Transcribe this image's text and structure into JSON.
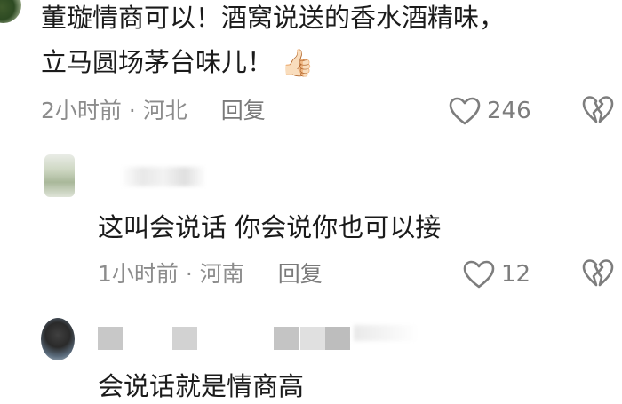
{
  "comment1": {
    "line1": "董璇情商可以！酒窝说送的香水酒精味，",
    "line2": "立马圆场茅台味儿！",
    "emoji": "👍🏻",
    "meta": "2小时前 · 河北",
    "reply_label": "回复",
    "likes": "246"
  },
  "comment2": {
    "text": "这叫会说话 你会说你也可以接",
    "meta": "1小时前 · 河南",
    "reply_label": "回复",
    "likes": "12"
  },
  "comment3": {
    "partial_text": "会说话就是情商高"
  },
  "icons": {
    "like": "heart-outline-icon",
    "dislike": "broken-heart-icon"
  },
  "colors": {
    "text": "#1b1b1b",
    "meta": "#8c8c8c",
    "icon": "#7d7d7d"
  }
}
